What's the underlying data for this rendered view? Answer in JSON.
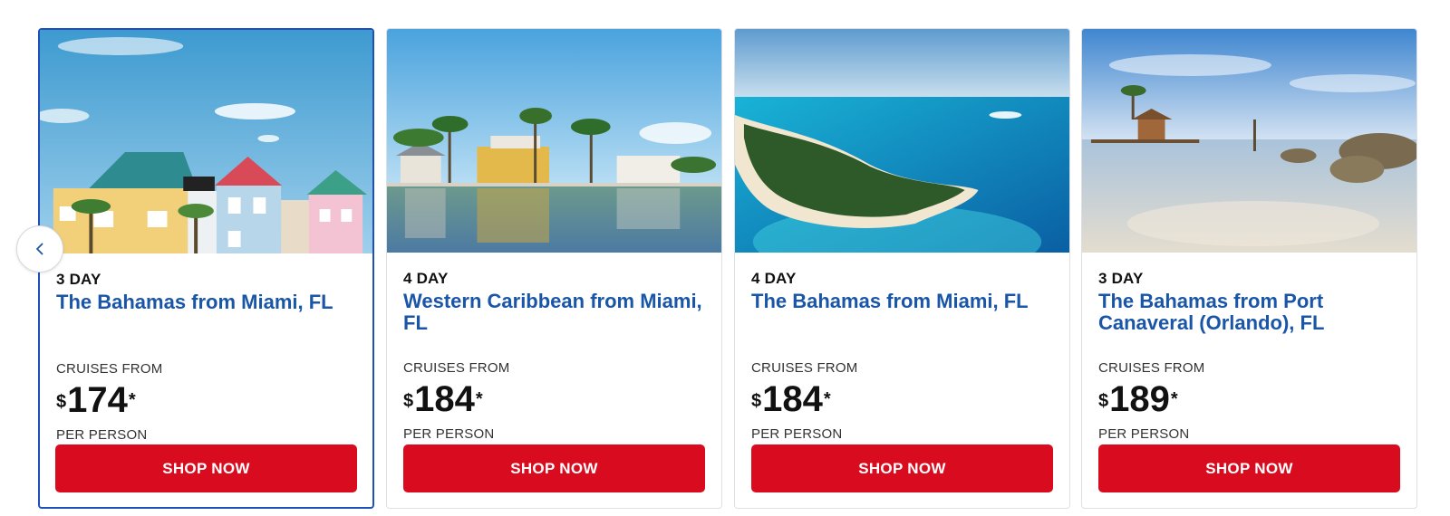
{
  "carousel": {
    "prev_icon": "chevron-left-icon",
    "accent_color": "#1f4fb8",
    "button_color": "#d90c1f",
    "title_color": "#1a56a8",
    "cards": [
      {
        "duration": "3 DAY",
        "title": "The Bahamas from Miami, FL",
        "from_label": "CRUISES FROM",
        "currency": "$",
        "price": "174",
        "asterisk": "*",
        "per_label": "PER PERSON",
        "cta": "SHOP NOW"
      },
      {
        "duration": "4 DAY",
        "title": "Western Caribbean from Miami, FL",
        "from_label": "CRUISES FROM",
        "currency": "$",
        "price": "184",
        "asterisk": "*",
        "per_label": "PER PERSON",
        "cta": "SHOP NOW"
      },
      {
        "duration": "4 DAY",
        "title": "The Bahamas from Miami, FL",
        "from_label": "CRUISES FROM",
        "currency": "$",
        "price": "184",
        "asterisk": "*",
        "per_label": "PER PERSON",
        "cta": "SHOP NOW"
      },
      {
        "duration": "3 DAY",
        "title": "The Bahamas from Port Canaveral (Orlando), FL",
        "from_label": "CRUISES FROM",
        "currency": "$",
        "price": "189",
        "asterisk": "*",
        "per_label": "PER PERSON",
        "cta": "SHOP NOW"
      }
    ]
  }
}
